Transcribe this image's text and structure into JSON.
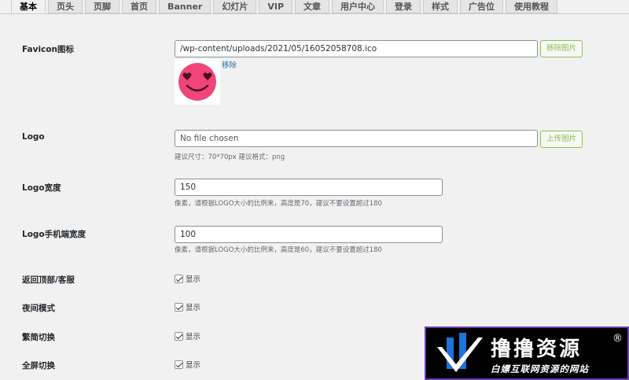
{
  "tabs": [
    {
      "label": "基本",
      "active": true
    },
    {
      "label": "页头"
    },
    {
      "label": "页脚"
    },
    {
      "label": "首页"
    },
    {
      "label": "Banner"
    },
    {
      "label": "幻灯片"
    },
    {
      "label": "VIP"
    },
    {
      "label": "文章"
    },
    {
      "label": "用户中心"
    },
    {
      "label": "登录"
    },
    {
      "label": "样式"
    },
    {
      "label": "广告位"
    },
    {
      "label": "使用教程"
    }
  ],
  "favicon": {
    "label": "Favicon图标",
    "value": "/wp-content/uploads/2021/05/16052058708.ico",
    "button": "移除图片",
    "remove_link": "移除"
  },
  "logo": {
    "label": "Logo",
    "value": "No file chosen",
    "button": "上传图片",
    "hint": "建议尺寸：70*70px 建议格式：png"
  },
  "logo_width": {
    "label": "Logo宽度",
    "value": "150",
    "hint": "像素，请根据LOGO大小的比例来，高度是70，建议不要设置超过180"
  },
  "logo_mobile_width": {
    "label": "Logo手机端宽度",
    "value": "100",
    "hint": "像素，请根据LOGO大小的比例来，高度是60，建议不要设置超过180"
  },
  "back_top": {
    "label": "返回顶部/客服",
    "check": "显示"
  },
  "night_mode": {
    "label": "夜间模式",
    "check": "显示"
  },
  "trad_simp": {
    "label": "繁简切换",
    "check": "显示"
  },
  "fullscreen": {
    "label": "全屏切换",
    "check": "显示"
  },
  "watermark": {
    "title": "撸撸资源",
    "reg": "®",
    "subtitle": "白嫖互联网资源的网站"
  },
  "colors": {
    "accent_green": "#8bc34a",
    "link_blue": "#2271b1",
    "favicon_pink": "#f0457a"
  }
}
